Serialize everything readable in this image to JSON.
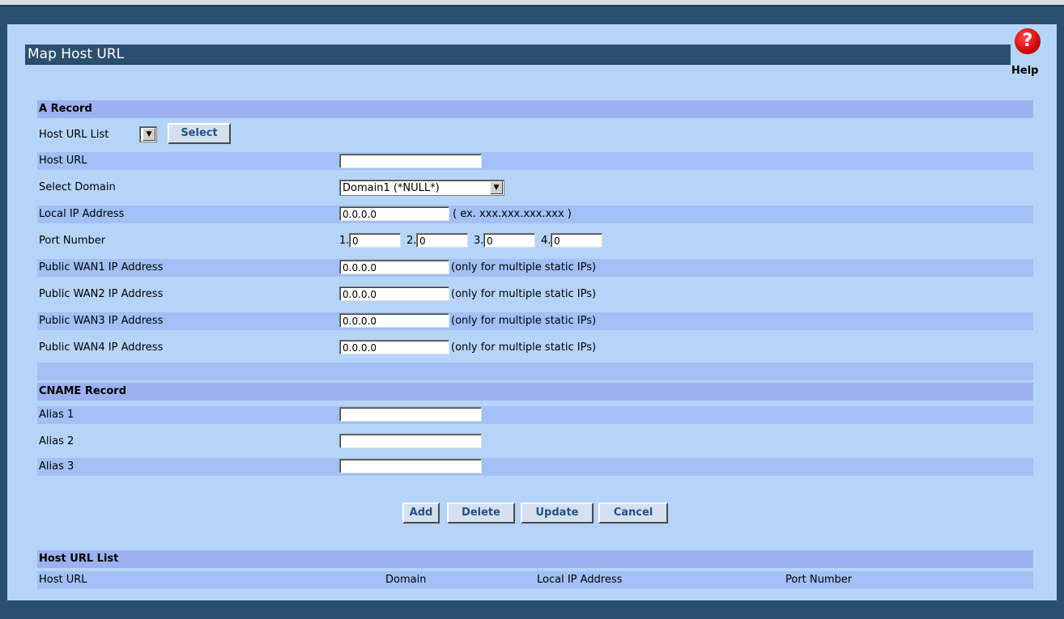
{
  "page": {
    "title": "Map Host URL",
    "help_label": "Help",
    "help_glyph": "?"
  },
  "a_record": {
    "header": "A Record",
    "host_url_list_label": "Host URL List",
    "select_button": "Select",
    "host_url_label": "Host URL",
    "host_url_value": "",
    "select_domain_label": "Select Domain",
    "select_domain_value": "Domain1 (*NULL*)",
    "local_ip_label": "Local IP Address",
    "local_ip_value": "0.0.0.0",
    "local_ip_hint": "( ex. xxx.xxx.xxx.xxx )",
    "port_number_label": "Port Number",
    "ports": [
      {
        "label": "1.",
        "value": "0"
      },
      {
        "label": "2.",
        "value": "0"
      },
      {
        "label": "3.",
        "value": "0"
      },
      {
        "label": "4.",
        "value": "0"
      }
    ],
    "wan": [
      {
        "label": "Public WAN1 IP Address",
        "value": "0.0.0.0",
        "hint": "(only for multiple static IPs)"
      },
      {
        "label": "Public WAN2 IP Address",
        "value": "0.0.0.0",
        "hint": "(only for multiple static IPs)"
      },
      {
        "label": "Public WAN3 IP Address",
        "value": "0.0.0.0",
        "hint": "(only for multiple static IPs)"
      },
      {
        "label": "Public WAN4 IP Address",
        "value": "0.0.0.0",
        "hint": "(only for multiple static IPs)"
      }
    ]
  },
  "cname_record": {
    "header": "CNAME Record",
    "aliases": [
      {
        "label": "Alias 1",
        "value": ""
      },
      {
        "label": "Alias 2",
        "value": ""
      },
      {
        "label": "Alias 3",
        "value": ""
      }
    ]
  },
  "actions": {
    "add": "Add",
    "delete": "Delete",
    "update": "Update",
    "cancel": "Cancel"
  },
  "host_url_list": {
    "header": "Host URL List",
    "columns": [
      "Host URL",
      "Domain",
      "Local IP Address",
      "Port Number"
    ]
  },
  "colors": {
    "frame": "#2b4f6f",
    "panel": "#b6d4f7",
    "row_alt": "#a2c0f5",
    "header_row": "#9db1f2",
    "button_text": "#23508a"
  },
  "icons": {
    "help": "help-icon",
    "dropdown": "chevron-down-icon"
  }
}
